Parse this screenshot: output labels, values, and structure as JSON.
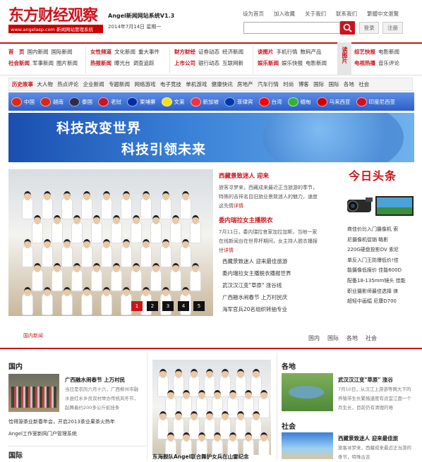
{
  "header": {
    "logo_title": "东方财经观察",
    "logo_sub": "www.angelasp.com 新闻网站管理系统",
    "system_name": "Angel新闻网站系统V1.3",
    "date": "2014年7月14日 星期一",
    "top_links": [
      "设为首页",
      "加入收藏",
      "关于我们",
      "联系我们",
      "繁體中文瀏覽"
    ],
    "search_placeholder": "",
    "login_label": "登录",
    "register_label": "注册"
  },
  "nav": {
    "groups": [
      {
        "rows": [
          {
            "head": "首　页",
            "items": [
              "国内新闻",
              "国际新闻"
            ]
          },
          {
            "head": "社会新闻",
            "items": [
              "军事新闻",
              "图片新闻"
            ]
          }
        ]
      },
      {
        "rows": [
          {
            "head": "女性频道",
            "items": [
              "文化新闻",
              "重大事件"
            ]
          },
          {
            "head": "热报新闻",
            "items": [
              "曝光台",
              "调查追踪"
            ]
          }
        ]
      },
      {
        "rows": [
          {
            "head": "财方财经",
            "items": [
              "证券动态",
              "经济新闻"
            ]
          },
          {
            "head": "上市公司",
            "items": [
              "银行动态",
              "互联网新"
            ]
          }
        ]
      },
      {
        "rows": [
          {
            "head": "谈图片",
            "items": [
              "手机行情",
              "数码产品"
            ]
          },
          {
            "head": "娱乐新闻",
            "items": [
              "娱乐快报",
              "电影新闻"
            ]
          }
        ]
      },
      {
        "rows": [
          {
            "head": "综艺快报",
            "items": [
              "电影新闻"
            ]
          },
          {
            "head": "电视热播",
            "items": [
              "音乐评论"
            ]
          }
        ]
      }
    ],
    "pic_label": "读图片"
  },
  "topics": {
    "head": "历史故事",
    "items": [
      "大人物",
      "热点评论",
      "企业新闻",
      "专题新闻",
      "网络游戏",
      "电子竞技",
      "单机游戏",
      "健康快讯",
      "房地产",
      "汽车行情",
      "时尚",
      "博客",
      "国际",
      "国际",
      "各地",
      "社会"
    ]
  },
  "countries": [
    {
      "name": "中国",
      "color": "#de2910"
    },
    {
      "name": "越南",
      "color": "#da251d"
    },
    {
      "name": "泰国",
      "color": "#2d2a4a"
    },
    {
      "name": "老挝",
      "color": "#ce1126"
    },
    {
      "name": "柬埔寨",
      "color": "#032ea1"
    },
    {
      "name": "文莱",
      "color": "#f7e017"
    },
    {
      "name": "新加坡",
      "color": "#ef3340"
    },
    {
      "name": "菲律宾",
      "color": "#0038a8"
    },
    {
      "name": "台湾",
      "color": "#fe0000"
    },
    {
      "name": "缅甸",
      "color": "#34b233"
    },
    {
      "name": "马来西亚",
      "color": "#cc0001"
    },
    {
      "name": "印度尼西亚",
      "color": "#ce1126"
    }
  ],
  "banner": {
    "line1": "科技改变世界",
    "line2": "科技引领未来"
  },
  "slideshow": {
    "pages": [
      "1",
      "2",
      "3",
      "4",
      "5"
    ],
    "active": 0
  },
  "center": {
    "headline1": "西藏景致迷人 迎来",
    "para1": "旅客寻梦来，西藏成来最近正当旅游的季节，特殊的吉祥名目旧旅业景致迷人的魅力，速度这先情",
    "more1": "详情",
    "headline2": "委内瑞拉女主播脱衣",
    "para2": "7月11日，委内瑞拉官家加拉加斯，当地一家在线新闻台在世界杯期间，女主持人脱衣播报世",
    "more2": "详情",
    "list": [
      "西藏景致迷人 迎来最佳旅游",
      "委内瑞拉女主播脱衣播报世界",
      "武汉汉江变\"草原\" 涨谷线",
      "广西融水闹春节 上万村民庆",
      "海军官兵20名组织转抽专业"
    ]
  },
  "today": {
    "title": "今日头条",
    "list": [
      "商佳价比入门摄像机 索",
      "尼摄像机促销 略影",
      "220G硬盘投影DV 索尼",
      "单反入门王防爆低价!佳",
      "能摄像低报价 佳能600D",
      "配备18-135mm镜头 佳能",
      "职业摄影师最佳选择 徕",
      "超轻中画幅 尼康D700"
    ]
  },
  "tabs": {
    "local_label": "国内新闻",
    "items": [
      "国内",
      "国际",
      "各地",
      "社会"
    ]
  },
  "bottom": {
    "domestic": {
      "title": "国内",
      "headline": "广西融水闹春节 上万村民",
      "para": "当日是农历六月十六，广西柳州市融水县红水乡良双村举办传统风冬节，起舞着约200多公斤蛇挂条",
      "list": [
        "恰得源茶业新春年会，开启2013茶业果茶火热年",
        "Angel工作室新网门户管理系统"
      ]
    },
    "international_title": "国际",
    "center_caption": "东海舰队Angel联合舞护女兵在山雷纪念",
    "local": {
      "title": "各地",
      "headline": "武汉汉江变\"草原\" 涨谷",
      "para": "7月10日，从汉江上游游等两大下的养殖带生长繁殖速度有适宜江面一个月生长，目前仍有清理的难"
    },
    "society": {
      "title": "社会",
      "headline": "西藏景致迷人 迎来最佳旅",
      "para": "旅客寻梦来，西藏成来最近正当游的季节，特殊古吉"
    }
  },
  "colors": {
    "accent": "#c8151b",
    "country_bar": "#2c5fc7",
    "banner": "#3b82d8"
  }
}
